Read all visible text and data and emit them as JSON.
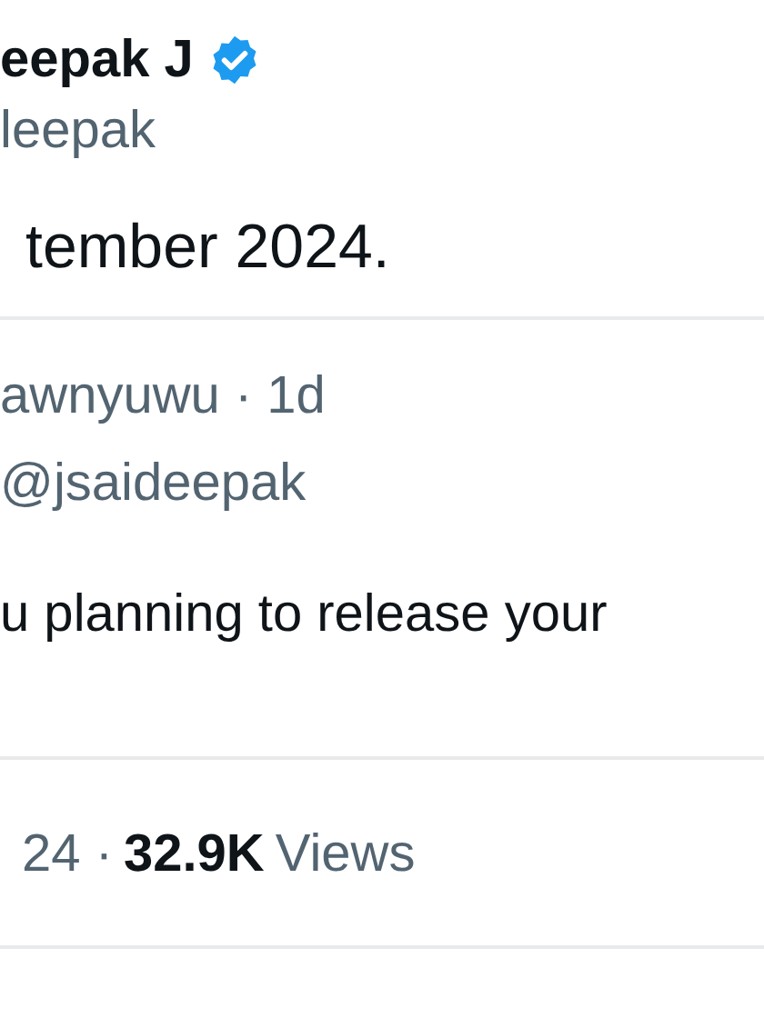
{
  "author": {
    "name": "eepak J",
    "verified": true,
    "handle": "leepak"
  },
  "tweet_text": "tember 2024.",
  "reply": {
    "meta": "awnyuwu · 1d",
    "replying_to": "@jsaideepak",
    "text": "u planning to release your"
  },
  "footer": {
    "date": "24 ·",
    "views_count": "32.9K",
    "views_label": "Views"
  }
}
